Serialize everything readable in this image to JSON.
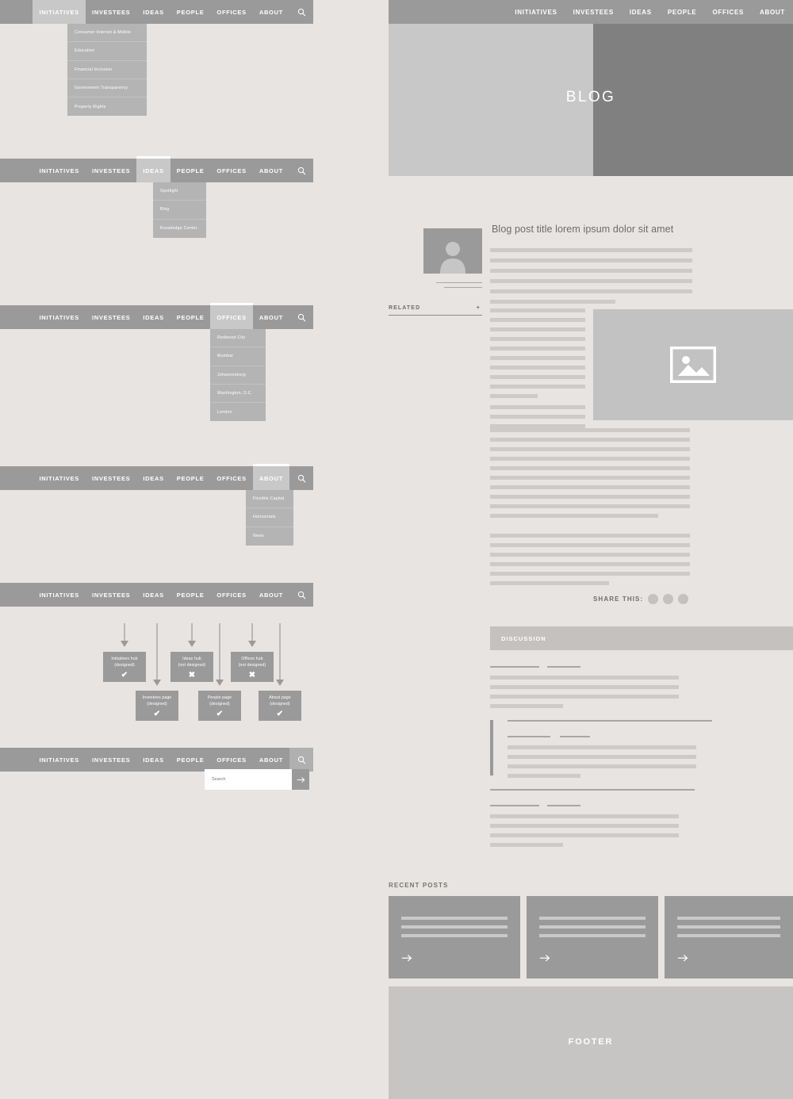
{
  "meta": {
    "colors": {
      "background": "#e8e4e1",
      "nav_gray": "#9a9a9a",
      "dropdown_gray": "#b4b4b4",
      "light_panel": "#c8c8c8",
      "dark_panel": "#808080",
      "text_gray": "#6f6c6a",
      "line_gray": "#cdcac8"
    }
  },
  "nav": {
    "items": [
      "INITIATIVES",
      "INVESTEES",
      "IDEAS",
      "PEOPLE",
      "OFFICES",
      "ABOUT"
    ],
    "search_icon": "search-icon"
  },
  "nav_states": [
    {
      "id": "initiatives",
      "active": "INITIATIVES",
      "dropdown": [
        "Consumer Internet & Mobile",
        "Education",
        "Financial Inclusion",
        "Government Transparency",
        "Property Rights"
      ]
    },
    {
      "id": "ideas",
      "active": "IDEAS",
      "dropdown": [
        "Spotlight",
        "Blog",
        "Knowledge Center"
      ]
    },
    {
      "id": "offices",
      "active": "OFFICES",
      "dropdown": [
        "Redwood City",
        "Mumbai",
        "Johannesburg",
        "Washington, D.C.",
        "London"
      ]
    },
    {
      "id": "about",
      "active": "ABOUT",
      "dropdown": [
        "Flexible Capital",
        "Horizontals",
        "News"
      ]
    },
    {
      "id": "sitemap",
      "active": null,
      "dropdown": []
    },
    {
      "id": "search",
      "active": null,
      "dropdown": []
    }
  ],
  "search": {
    "placeholder": "Search",
    "value": "",
    "submit_icon": "arrow-right-icon"
  },
  "flow": {
    "boxes": [
      {
        "title": "Initiatives hub",
        "status": "(designed)",
        "mark": "✔"
      },
      {
        "title": "Ideas hub",
        "status": "(not designed)",
        "mark": "✖"
      },
      {
        "title": "Offices hub",
        "status": "(not designed)",
        "mark": "✖"
      },
      {
        "title": "Investees page",
        "status": "(designed)",
        "mark": "✔"
      },
      {
        "title": "People page",
        "status": "(designed)",
        "mark": "✔"
      },
      {
        "title": "About page",
        "status": "(designed)",
        "mark": "✔"
      }
    ]
  },
  "blog": {
    "hero_title": "BLOG",
    "post_title": "Blog post title lorem ipsum dolor sit amet",
    "avatar_icon": "person-avatar-icon",
    "related_label": "RELATED",
    "related_expand": "+",
    "image_placeholder_icon": "image-placeholder-icon",
    "share_label": "SHARE THIS:",
    "share_count": 3,
    "discussion_label": "DISCUSSION",
    "recent_label": "RECENT POSTS",
    "recent_cards": [
      {
        "lines": 3,
        "arrow": "arrow-right-icon"
      },
      {
        "lines": 3,
        "arrow": "arrow-right-icon"
      },
      {
        "lines": 3,
        "arrow": "arrow-right-icon"
      }
    ],
    "footer_label": "FOOTER"
  }
}
